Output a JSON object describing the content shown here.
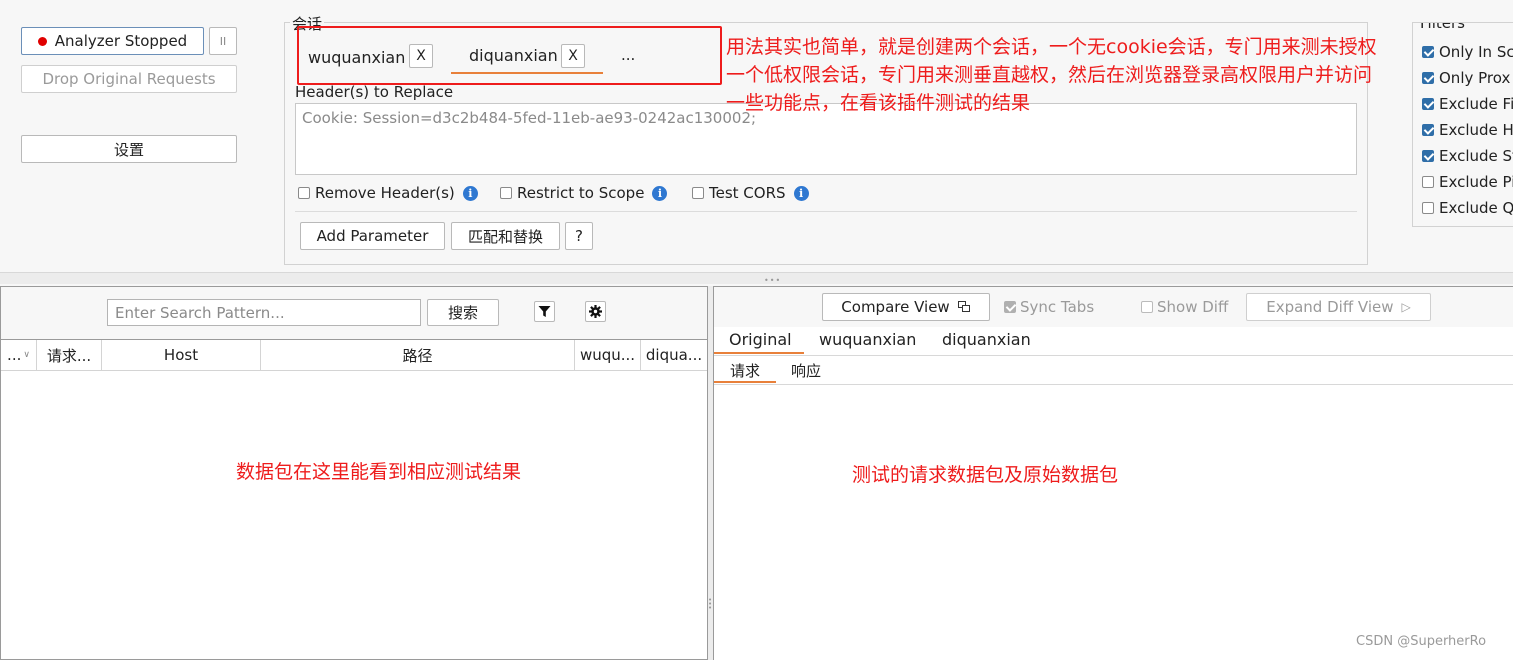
{
  "left_panel": {
    "analyzer_status": "Analyzer Stopped",
    "pause_glyph": "II",
    "drop_requests": "Drop Original Requests",
    "settings": "设置"
  },
  "session": {
    "section_label": "会话",
    "tabs": [
      {
        "name": "wuquanxian",
        "close": "X"
      },
      {
        "name": "diquanxian",
        "close": "X"
      }
    ],
    "more": "...",
    "headers_label": "Header(s) to Replace",
    "headers_value": "Cookie: Session=d3c2b484-5fed-11eb-ae93-0242ac130002;",
    "options": {
      "remove_headers": "Remove Header(s)",
      "restrict_scope": "Restrict to Scope",
      "test_cors": "Test CORS"
    },
    "info_glyph": "i",
    "add_parameter": "Add Parameter",
    "match_replace": "匹配和替换",
    "help": "?"
  },
  "annotations": {
    "top_line1": "用法其实也简单，就是创建两个会话，一个无cookie会话，专门用来测未授权",
    "top_line2": "一个低权限会话，专门用来测垂直越权，然后在浏览器登录高权限用户并访问",
    "top_line3": "一些功能点，在看该插件测试的结果",
    "left_note": "数据包在这里能看到相应测试结果",
    "right_note": "测试的请求数据包及原始数据包"
  },
  "filters": {
    "title": "Filters",
    "items": [
      {
        "label": "Only In Sc",
        "checked": true
      },
      {
        "label": "Only Prox",
        "checked": true
      },
      {
        "label": "Exclude Fi",
        "checked": true
      },
      {
        "label": "Exclude H",
        "checked": true
      },
      {
        "label": "Exclude St",
        "checked": true
      },
      {
        "label": "Exclude Pi",
        "checked": false
      },
      {
        "label": "Exclude Q",
        "checked": false
      }
    ]
  },
  "table": {
    "search_placeholder": "Enter Search Pattern...",
    "search_button": "搜索",
    "columns": [
      "...",
      "请求...",
      "Host",
      "路径",
      "wuqu...",
      "diqua..."
    ]
  },
  "diff": {
    "compare_view": "Compare View",
    "sync_tabs": "Sync Tabs",
    "show_diff": "Show Diff",
    "expand_diff": "Expand Diff View",
    "view_tabs": [
      "Original",
      "wuquanxian",
      "diquanxian"
    ],
    "sub_tabs": [
      "请求",
      "响应"
    ]
  },
  "watermark": "CSDN @SuperherRo"
}
